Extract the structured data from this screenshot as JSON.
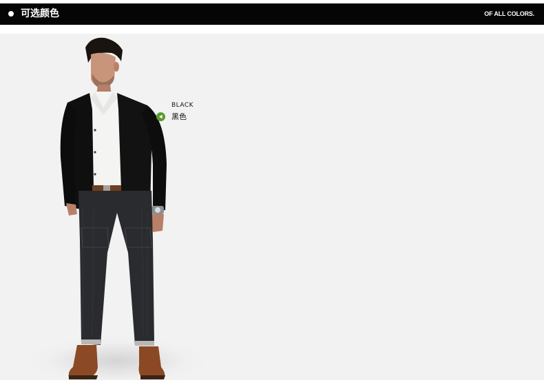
{
  "header": {
    "title": "可选颜色",
    "subtitle": "OF ALL COLORS."
  },
  "color_option": {
    "name_en": "BLACK",
    "name_cn": "黑色",
    "marker_icon": "play-left-circle-icon",
    "marker_color": "#5a9a2c"
  },
  "colors": {
    "header_bg": "#050505",
    "stage_bg": "#f2f2f2"
  }
}
